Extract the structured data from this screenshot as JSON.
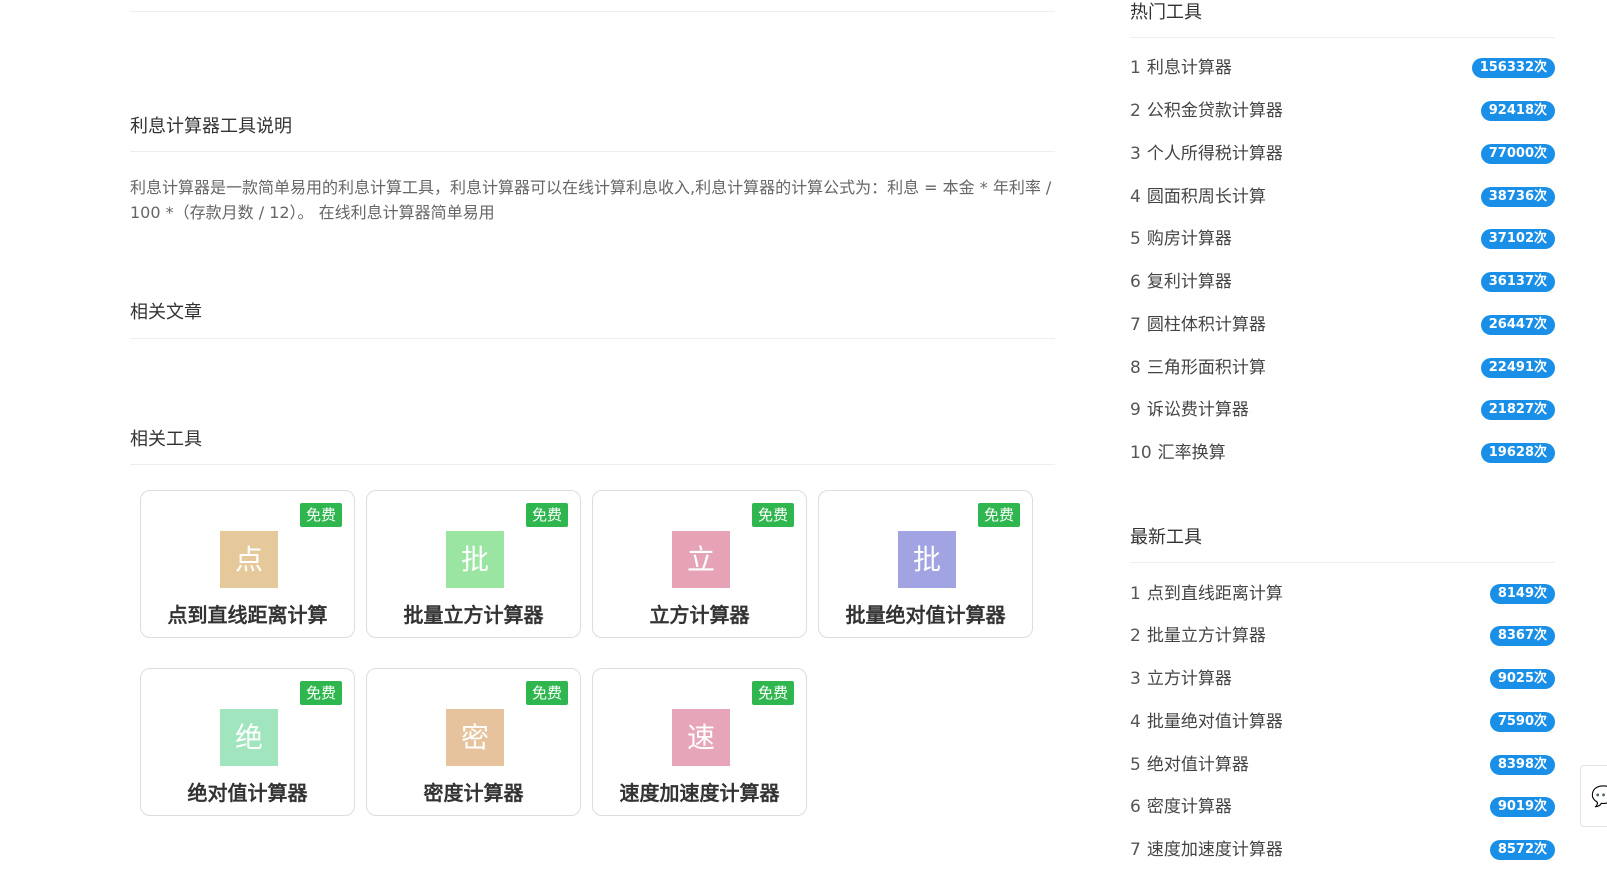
{
  "article": {
    "intro_title": "利息计算器工具说明",
    "intro_text": "利息计算器是一款简单易用的利息计算工具，利息计算器可以在线计算利息收入,利息计算器的计算公式为：利息 = 本金 * 年利率 / 100 *（存款月数 / 12）。 在线利息计算器简单易用",
    "related_articles_title": "相关文章",
    "related_tools_title": "相关工具"
  },
  "related_tools": [
    {
      "name": "点到直线距离计算",
      "glyph": "点",
      "color": "#e5c99b",
      "badge": "免费"
    },
    {
      "name": "批量立方计算器",
      "glyph": "批",
      "color": "#9ae5a2",
      "badge": "免费"
    },
    {
      "name": "立方计算器",
      "glyph": "立",
      "color": "#e5a3b5",
      "badge": "免费"
    },
    {
      "name": "批量绝对值计算器",
      "glyph": "批",
      "color": "#a1a3e2",
      "badge": "免费"
    },
    {
      "name": "绝对值计算器",
      "glyph": "绝",
      "color": "#a1e5be",
      "badge": "免费"
    },
    {
      "name": "密度计算器",
      "glyph": "密",
      "color": "#e6c39c",
      "badge": "免费"
    },
    {
      "name": "速度加速度计算器",
      "glyph": "速",
      "color": "#e7a5b9",
      "badge": "免费"
    }
  ],
  "sidebar": {
    "hot_title": "热门工具",
    "hot": [
      {
        "rank": "1",
        "name": "利息计算器",
        "count": "156332次"
      },
      {
        "rank": "2",
        "name": "公积金贷款计算器",
        "count": "92418次"
      },
      {
        "rank": "3",
        "name": "个人所得税计算器",
        "count": "77000次"
      },
      {
        "rank": "4",
        "name": "圆面积周长计算",
        "count": "38736次"
      },
      {
        "rank": "5",
        "name": "购房计算器",
        "count": "37102次"
      },
      {
        "rank": "6",
        "name": "复利计算器",
        "count": "36137次"
      },
      {
        "rank": "7",
        "name": "圆柱体积计算器",
        "count": "26447次"
      },
      {
        "rank": "8",
        "name": "三角形面积计算",
        "count": "22491次"
      },
      {
        "rank": "9",
        "name": "诉讼费计算器",
        "count": "21827次"
      },
      {
        "rank": "10",
        "name": "汇率换算",
        "count": "19628次"
      }
    ],
    "new_title": "最新工具",
    "new": [
      {
        "rank": "1",
        "name": "点到直线距离计算",
        "count": "8149次"
      },
      {
        "rank": "2",
        "name": "批量立方计算器",
        "count": "8367次"
      },
      {
        "rank": "3",
        "name": "立方计算器",
        "count": "9025次"
      },
      {
        "rank": "4",
        "name": "批量绝对值计算器",
        "count": "7590次"
      },
      {
        "rank": "5",
        "name": "绝对值计算器",
        "count": "8398次"
      },
      {
        "rank": "6",
        "name": "密度计算器",
        "count": "9019次"
      },
      {
        "rank": "7",
        "name": "速度加速度计算器",
        "count": "8572次"
      }
    ],
    "badge_color": "#1a8fe8"
  },
  "float_button": {
    "icon": "chat-icon"
  }
}
